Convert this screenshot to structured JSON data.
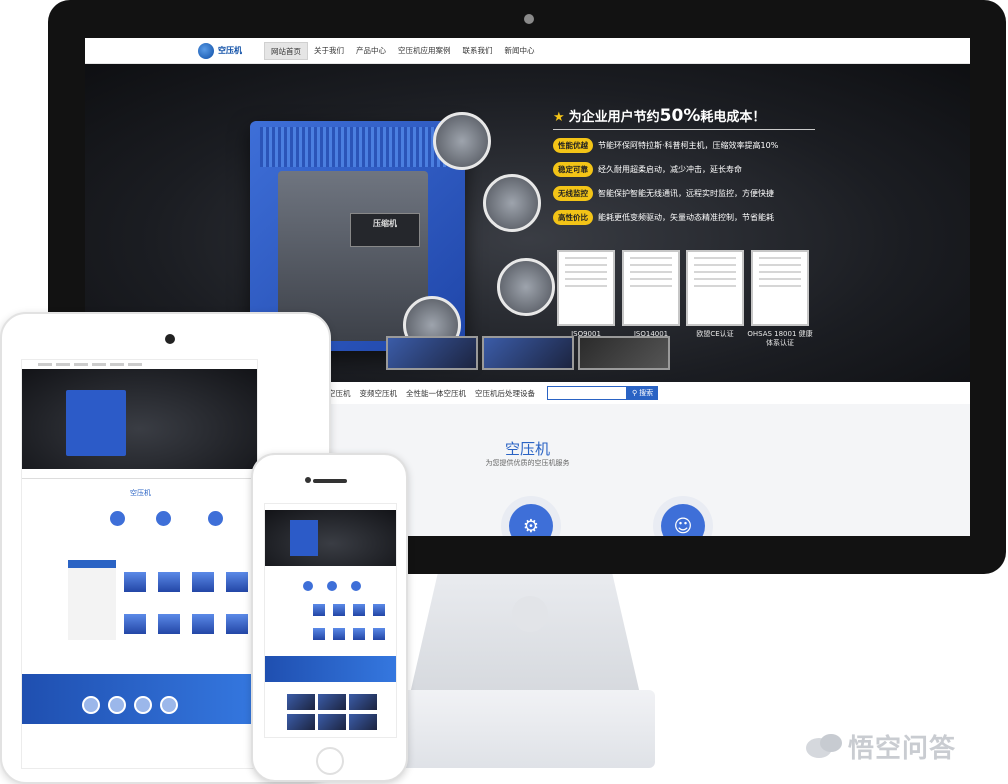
{
  "desktop": {
    "nav": {
      "logo_text": "空压机",
      "items": [
        "网站首页",
        "关于我们",
        "产品中心",
        "空压机应用案例",
        "联系我们",
        "新闻中心"
      ]
    },
    "banner": {
      "headline_pre": "为企业用户节约",
      "headline_pct": "50%",
      "headline_post": "耗电成本！",
      "features": [
        {
          "tag": "性能优越",
          "text": "节能环保阿特拉斯·科普柯主机，压缩效率提高10%"
        },
        {
          "tag": "稳定可靠",
          "text": "经久耐用超柔启动，减少冲击，延长寿命"
        },
        {
          "tag": "无线监控",
          "text": "智能保护智能无线通讯，远程实时监控，方便快捷"
        },
        {
          "tag": "高性价比",
          "text": "能耗更低变频驱动，矢量动态精准控制，节省能耗"
        }
      ],
      "certs": [
        "ISO9001",
        "ISO14001",
        "欧盟CE认证",
        "OHSAS 18001 健康体系认证"
      ],
      "machine_plate": "压缩机"
    },
    "subnav": {
      "items": [
        "空压机",
        "变频空压机",
        "全性能一体空压机",
        "空压机后处理设备"
      ],
      "search_placeholder": "",
      "search_button": "搜索"
    },
    "section": {
      "title": "空压机",
      "subtitle": "为您提供优质的空压机服务"
    }
  },
  "tablet": {
    "section_title": "空压机"
  },
  "watermark": {
    "text": "悟空问答"
  },
  "colors": {
    "brand_blue": "#2a63c4",
    "accent_yellow": "#f3c417",
    "banner_dark": "#1b1d22"
  }
}
